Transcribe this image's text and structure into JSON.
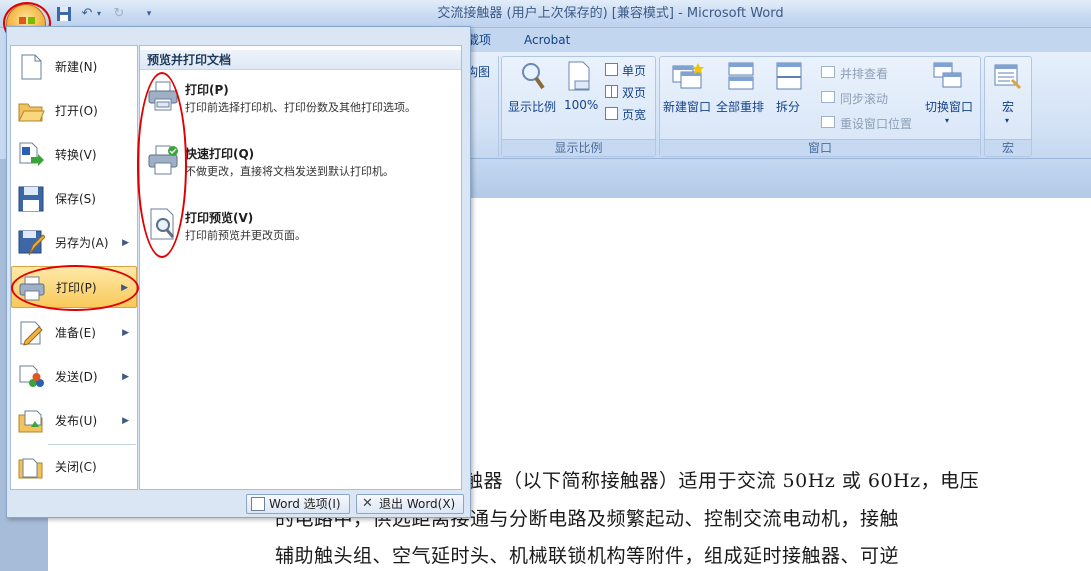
{
  "window": {
    "title": "交流接触器 (用户上次保存的) [兼容模式] - Microsoft Word"
  },
  "quick_access": {
    "items": [
      "save-icon",
      "undo-icon",
      "redo-icon",
      "customize-icon"
    ]
  },
  "ribbon": {
    "tabs": [
      {
        "label": "载项"
      },
      {
        "label": "Acrobat"
      }
    ],
    "partial_left_label": "构图",
    "groups": {
      "zoom": {
        "label": "显示比例",
        "zoom_button": "显示比例",
        "percent_button": "100%",
        "single_page": "单页",
        "two_pages": "双页",
        "page_width": "页宽"
      },
      "window": {
        "label": "窗口",
        "new_window": "新建窗口",
        "arrange_all": "全部重排",
        "split": "拆分",
        "side_by_side": "并排查看",
        "sync_scroll": "同步滚动",
        "reset_position": "重设窗口位置",
        "switch_window": "切换窗口"
      },
      "macros": {
        "label": "宏",
        "macros_button": "宏"
      }
    }
  },
  "office_menu": {
    "items": [
      {
        "label": "新建(N)",
        "has_submenu": false
      },
      {
        "label": "打开(O)",
        "has_submenu": false
      },
      {
        "label": "转换(V)",
        "has_submenu": false
      },
      {
        "label": "保存(S)",
        "has_submenu": false
      },
      {
        "label": "另存为(A)",
        "has_submenu": true
      },
      {
        "label": "打印(P)",
        "has_submenu": true
      },
      {
        "label": "准备(E)",
        "has_submenu": true
      },
      {
        "label": "发送(D)",
        "has_submenu": true
      },
      {
        "label": "发布(U)",
        "has_submenu": true
      },
      {
        "label": "关闭(C)",
        "has_submenu": false
      }
    ],
    "submenu": {
      "header": "预览并打印文档",
      "items": [
        {
          "title": "打印(P)",
          "desc": "打印前选择打印机、打印份数及其他打印选项。"
        },
        {
          "title": "快速打印(Q)",
          "desc": "不做更改，直接将文档发送到默认打印机。"
        },
        {
          "title": "打印预览(V)",
          "desc": "打印前预览并更改页面。"
        }
      ]
    },
    "word_options": "Word 选项(I)",
    "exit_word": "退出 Word(X)"
  },
  "document": {
    "lines": [
      "触器（以下简称接触器）适用于交流 50Hz 或 60Hz，电压",
      "的电路中，供远距离接通与分断电路及频繁起动、控制交流电动机，接触",
      "辅助触头组、空气延时头、机械联锁机构等附件，组成延时接触器、可逆"
    ]
  },
  "colors": {
    "highlight_ring": "#e00000",
    "menu_selected": "#f9c95a",
    "ribbon_text": "#15428b"
  }
}
